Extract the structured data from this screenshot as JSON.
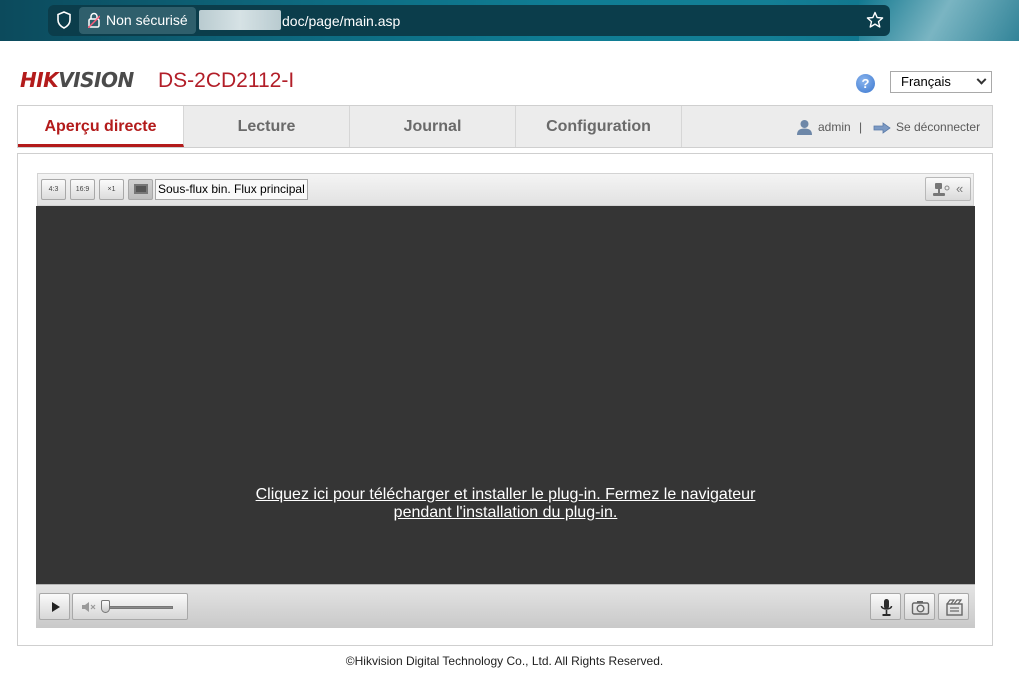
{
  "browser": {
    "security_label": "Non sécurisé",
    "url_suffix": "doc/page/main.asp"
  },
  "header": {
    "logo_red": "HIK",
    "logo_rest": "VISION",
    "model": "DS-2CD2112-I",
    "help_icon": "help-icon",
    "language": "Français"
  },
  "nav": {
    "tabs": [
      {
        "label": "Aperçu directe",
        "active": true
      },
      {
        "label": "Lecture",
        "active": false
      },
      {
        "label": "Journal",
        "active": false
      },
      {
        "label": "Configuration",
        "active": false
      }
    ],
    "user": "admin",
    "separator": "|",
    "logout": "Se déconnecter"
  },
  "toolbar": {
    "ratio_43": "4:3",
    "ratio_169": "16:9",
    "ratio_x1": "×1",
    "streams_label": "Sous-flux bin. Flux principal"
  },
  "video": {
    "plugin_line1": "Cliquez ici pour télécharger et installer le plug-in. Fermez le navigateur",
    "plugin_line2": "pendant l'installation du plug-in."
  },
  "controls": {
    "volume_level": 0,
    "icons": [
      "play-icon",
      "speaker-mute-icon",
      "microphone-icon",
      "camera-icon",
      "record-icon"
    ]
  },
  "footer": {
    "copyright": "©Hikvision Digital Technology Co., Ltd. All Rights Reserved."
  },
  "colors": {
    "brand_red": "#b31b1b",
    "video_bg": "#353535",
    "nav_bg": "#ececec"
  }
}
